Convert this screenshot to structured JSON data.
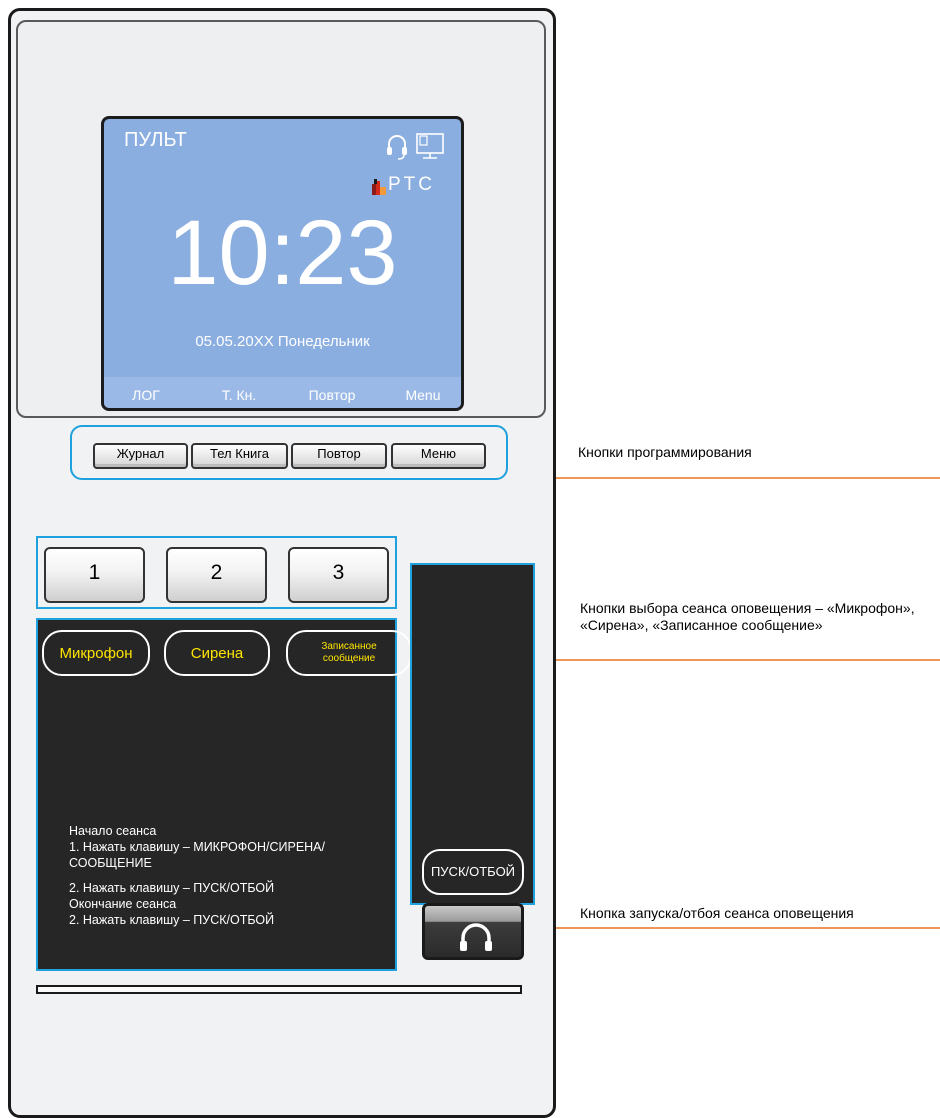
{
  "screen": {
    "title": "ПУЛЬТ",
    "logo_text": "PTC",
    "time": "10:23",
    "date": "05.05.20XX Понедельник",
    "softkeys": [
      "ЛОГ",
      "Т. Кн.",
      "Повтор",
      "Menu"
    ]
  },
  "programming_buttons": [
    "Журнал",
    "Тел Книга",
    "Повтор",
    "Меню"
  ],
  "number_buttons": [
    "1",
    "2",
    "3"
  ],
  "session_buttons": [
    "Микрофон",
    "Сирена",
    "Записанное сообщение"
  ],
  "instructions": [
    "Начало сеанса",
    "1. Нажать клавишу – МИКРОФОН/СИРЕНА/\nСООБЩЕНИЕ",
    "2. Нажать клавишу – ПУСК/ОТБОЙ",
    "Окончание сеанса",
    "2. Нажать клавишу – ПУСК/ОТБОЙ"
  ],
  "launch_label": "ПУСК/ОТБОЙ",
  "callouts": {
    "programming": "Кнопки программирования",
    "session_select": "Кнопки выбора сеанса оповещения – «Микрофон», «Сирена», «Записанное сообщение»",
    "launch": "Кнопка запуска/отбоя сеанса оповещения"
  },
  "colors": {
    "screen": "#8aaee0",
    "group_border": "#1ea1dc",
    "leader_line": "#e8741c",
    "session_text": "#ffe500",
    "panel_dark": "#262626"
  }
}
